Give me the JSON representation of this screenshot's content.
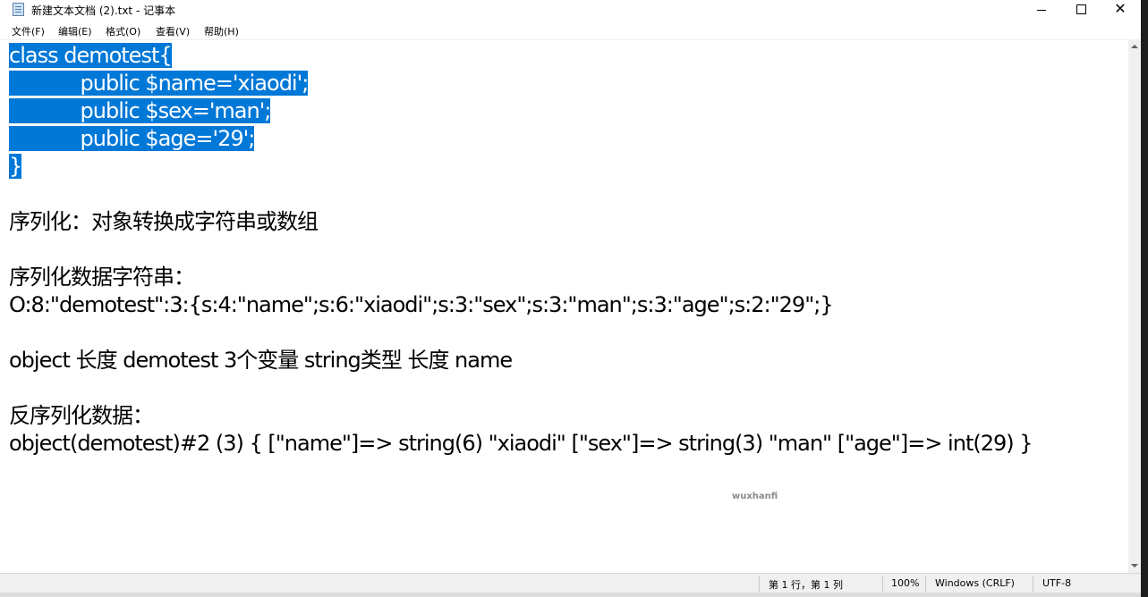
{
  "window": {
    "title": "新建文本文档 (2).txt - 记事本",
    "minimize": "—",
    "maximize": "☐",
    "close": "✕"
  },
  "menu": [
    "文件(F)",
    "编辑(E)",
    "格式(O)",
    "查看(V)",
    "帮助(H)"
  ],
  "editor": {
    "lines": [
      "class demotest{",
      "            public $name='xiaodi';",
      "            public $sex='man';",
      "            public $age='29';",
      "}",
      "",
      "序列化：对象转换成字符串或数组",
      "",
      "序列化数据字符串：",
      "O:8:\"demotest\":3:{s:4:\"name\";s:6:\"xiaodi\";s:3:\"sex\";s:3:\"man\";s:3:\"age\";s:2:\"29\";}",
      "",
      "object 长度 demotest 3个变量 string类型 长度 name",
      "",
      "反序列化数据：",
      "object(demotest)#2 (3) { [\"name\"]=> string(6) \"xiaodi\" [\"sex\"]=> string(3) \"man\" [\"age\"]=> int(29) }"
    ],
    "selected_lines": [
      0,
      1,
      2,
      3,
      4
    ],
    "selection_color": "#0078d7"
  },
  "watermark": "wuxhanfi",
  "statusbar": {
    "position": "第 1 行，第 1 列",
    "zoom": "100%",
    "line_ending": "Windows (CRLF)",
    "encoding": "UTF-8"
  }
}
